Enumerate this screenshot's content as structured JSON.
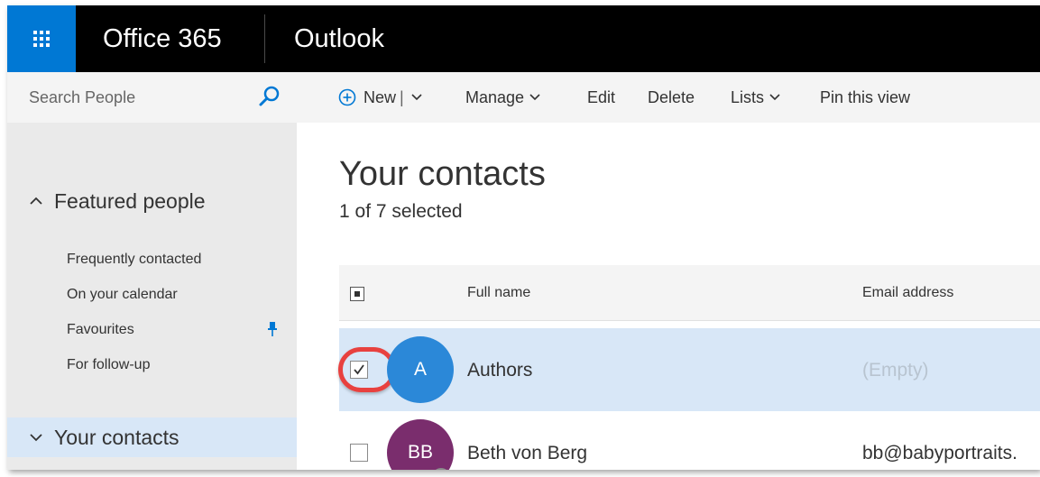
{
  "topbar": {
    "waffle_icon": "app-launcher-icon",
    "brand": "Office 365",
    "app": "Outlook"
  },
  "leftrail": {
    "search": {
      "placeholder": "Search People",
      "value": "",
      "icon": "search-icon"
    },
    "featured": {
      "label": "Featured people",
      "expanded": true
    },
    "items": [
      {
        "label": "Frequently contacted"
      },
      {
        "label": "On your calendar"
      },
      {
        "label": "Favourites",
        "pinned": true
      },
      {
        "label": "For follow-up"
      }
    ],
    "your_contacts": {
      "label": "Your contacts",
      "expanded": true,
      "selected": true
    }
  },
  "commands": {
    "new": "New",
    "manage": "Manage",
    "edit": "Edit",
    "delete": "Delete",
    "lists": "Lists",
    "pin": "Pin this view"
  },
  "main": {
    "title": "Your contacts",
    "subtitle": "1 of 7 selected",
    "columns": {
      "name": "Full name",
      "email": "Email address"
    },
    "rows": [
      {
        "initials": "A",
        "name": "Authors",
        "email": "(Empty)",
        "checked": true,
        "avatar_color": "#2b88d8",
        "email_empty": true
      },
      {
        "initials": "BB",
        "name": "Beth von Berg",
        "email": "bb@babyportraits.",
        "checked": false,
        "avatar_color": "#7a2d6d",
        "email_empty": false
      }
    ]
  },
  "colors": {
    "brand_blue": "#0078d4",
    "selection": "#d8e7f7",
    "highlight_ring": "#e8413f"
  }
}
